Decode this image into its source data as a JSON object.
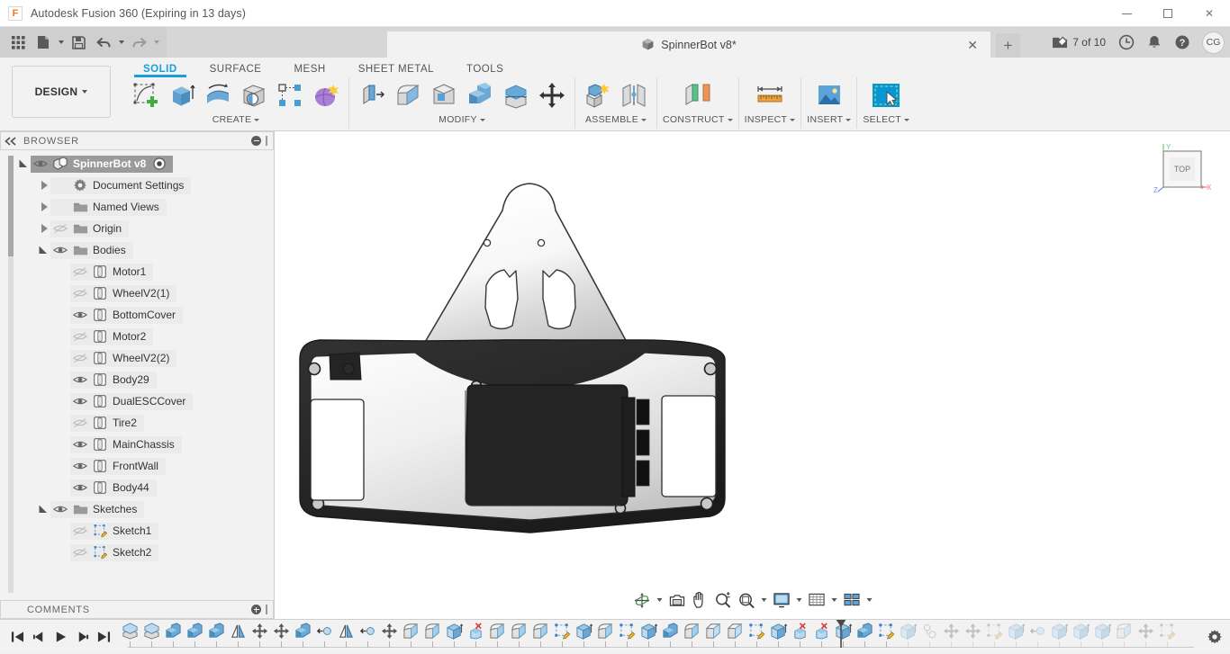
{
  "window": {
    "app_title": "Autodesk Fusion 360 (Expiring in 13 days)",
    "logo_letter": "F",
    "controls": {
      "minimize": "minimize",
      "maximize": "maximize",
      "close": "close"
    }
  },
  "quick_access": {
    "items": [
      {
        "name": "app-grid-button",
        "icon": "grid-icon"
      },
      {
        "name": "new-file-button",
        "icon": "file-icon",
        "has_caret": true
      },
      {
        "name": "save-button",
        "icon": "save-icon"
      },
      {
        "name": "undo-button",
        "icon": "undo-icon",
        "has_caret": true
      },
      {
        "name": "redo-button",
        "icon": "redo-icon",
        "has_caret": true
      }
    ]
  },
  "document_tab": {
    "label": "SpinnerBot v8*",
    "icon": "cube-icon",
    "close_glyph": "✕",
    "new_tab_glyph": "+"
  },
  "tab_right": {
    "job_status": "7 of 10",
    "job_icon": "job-status-icon",
    "history_icon": "clock-icon",
    "notification_icon": "bell-icon",
    "help_icon": "help-icon",
    "avatar_initials": "CG"
  },
  "workspace": {
    "label": "DESIGN"
  },
  "ribbon": {
    "tabs": [
      {
        "label": "SOLID",
        "active": true
      },
      {
        "label": "SURFACE",
        "active": false
      },
      {
        "label": "MESH",
        "active": false
      },
      {
        "label": "SHEET METAL",
        "active": false
      },
      {
        "label": "TOOLS",
        "active": false
      }
    ],
    "groups": [
      {
        "label": "CREATE",
        "has_caret": true,
        "icons": [
          "create-sketch-icon",
          "extrude-icon",
          "revolve-icon",
          "hole-icon",
          "pattern-icon",
          "form-icon"
        ]
      },
      {
        "label": "MODIFY",
        "has_caret": true,
        "icons": [
          "press-pull-icon",
          "fillet-icon",
          "shell-icon",
          "combine-icon",
          "offset-face-icon",
          "move-copy-icon"
        ]
      },
      {
        "label": "ASSEMBLE",
        "has_caret": true,
        "icons": [
          "new-component-icon",
          "joint-icon"
        ]
      },
      {
        "label": "CONSTRUCT",
        "has_caret": true,
        "icons": [
          "offset-plane-icon"
        ]
      },
      {
        "label": "INSPECT",
        "has_caret": true,
        "icons": [
          "measure-icon"
        ]
      },
      {
        "label": "INSERT",
        "has_caret": true,
        "icons": [
          "insert-image-icon"
        ]
      },
      {
        "label": "SELECT",
        "has_caret": true,
        "icons": [
          "select-window-icon"
        ]
      }
    ]
  },
  "browser": {
    "title": "BROWSER",
    "collapse_icon": "collapse-left-icon",
    "panel_button_icon": "minus-circle-icon",
    "tree": [
      {
        "label": "SpinnerBot v8",
        "depth": 0,
        "twisty": "down",
        "eye": "visible",
        "icon": "component-icon",
        "selected": true,
        "has_radio": true
      },
      {
        "label": "Document Settings",
        "depth": 1,
        "twisty": "right",
        "eye": "none",
        "icon": "gear-icon",
        "selected": false
      },
      {
        "label": "Named Views",
        "depth": 1,
        "twisty": "right",
        "eye": "none",
        "icon": "folder-icon",
        "selected": false
      },
      {
        "label": "Origin",
        "depth": 1,
        "twisty": "right",
        "eye": "hidden",
        "icon": "folder-icon",
        "selected": false
      },
      {
        "label": "Bodies",
        "depth": 1,
        "twisty": "down",
        "eye": "visible",
        "icon": "folder-icon",
        "selected": false
      },
      {
        "label": "Motor1",
        "depth": 2,
        "twisty": "none",
        "eye": "hidden",
        "icon": "body-icon",
        "selected": false
      },
      {
        "label": "WheelV2(1)",
        "depth": 2,
        "twisty": "none",
        "eye": "hidden",
        "icon": "body-icon",
        "selected": false
      },
      {
        "label": "BottomCover",
        "depth": 2,
        "twisty": "none",
        "eye": "visible",
        "icon": "body-icon",
        "selected": false
      },
      {
        "label": "Motor2",
        "depth": 2,
        "twisty": "none",
        "eye": "hidden",
        "icon": "body-icon",
        "selected": false
      },
      {
        "label": "WheelV2(2)",
        "depth": 2,
        "twisty": "none",
        "eye": "hidden",
        "icon": "body-icon",
        "selected": false
      },
      {
        "label": "Body29",
        "depth": 2,
        "twisty": "none",
        "eye": "visible",
        "icon": "body-icon",
        "selected": false
      },
      {
        "label": "DualESCCover",
        "depth": 2,
        "twisty": "none",
        "eye": "visible",
        "icon": "body-icon",
        "selected": false
      },
      {
        "label": "Tire2",
        "depth": 2,
        "twisty": "none",
        "eye": "hidden",
        "icon": "body-icon",
        "selected": false
      },
      {
        "label": "MainChassis",
        "depth": 2,
        "twisty": "none",
        "eye": "visible",
        "icon": "body-icon",
        "selected": false
      },
      {
        "label": "FrontWall",
        "depth": 2,
        "twisty": "none",
        "eye": "visible",
        "icon": "body-icon",
        "selected": false
      },
      {
        "label": "Body44",
        "depth": 2,
        "twisty": "none",
        "eye": "visible",
        "icon": "body-icon",
        "selected": false
      },
      {
        "label": "Sketches",
        "depth": 1,
        "twisty": "down",
        "eye": "visible",
        "icon": "folder-icon",
        "selected": false
      },
      {
        "label": "Sketch1",
        "depth": 2,
        "twisty": "none",
        "eye": "hidden",
        "icon": "sketch-icon",
        "selected": false
      },
      {
        "label": "Sketch2",
        "depth": 2,
        "twisty": "none",
        "eye": "hidden",
        "icon": "sketch-icon",
        "selected": false
      }
    ]
  },
  "comments": {
    "title": "COMMENTS",
    "add_icon": "plus-circle-icon"
  },
  "viewcube": {
    "face_label": "TOP",
    "axis_x": "X",
    "axis_y": "Y",
    "axis_z": "Z",
    "color_x": "#e87b7b",
    "color_y": "#7bc47b",
    "color_z": "#7b8be8"
  },
  "navbar": {
    "items": [
      {
        "name": "orbit-button",
        "icon": "orbit-icon",
        "caret": true
      },
      {
        "name": "look-at-button",
        "icon": "look-at-icon",
        "caret": false
      },
      {
        "name": "pan-button",
        "icon": "pan-hand-icon",
        "caret": false
      },
      {
        "name": "zoom-button",
        "icon": "zoom-icon",
        "caret": false
      },
      {
        "name": "fit-button",
        "icon": "fit-icon",
        "caret": true
      },
      {
        "name": "display-settings-button",
        "icon": "display-icon",
        "caret": true
      },
      {
        "name": "grid-snaps-button",
        "icon": "grid-snap-icon",
        "caret": true
      },
      {
        "name": "viewports-button",
        "icon": "viewports-icon",
        "caret": true
      }
    ]
  },
  "timeline": {
    "playback": [
      {
        "name": "go-to-beginning-button",
        "icon": "skip-back-icon"
      },
      {
        "name": "step-back-button",
        "icon": "step-back-icon"
      },
      {
        "name": "play-button",
        "icon": "play-icon"
      },
      {
        "name": "step-forward-button",
        "icon": "step-forward-icon"
      },
      {
        "name": "go-to-end-button",
        "icon": "skip-forward-icon"
      }
    ],
    "marker_index": 33,
    "settings_icon": "gear-icon",
    "features": [
      {
        "icon": "offset-face-icon",
        "suppressed": false
      },
      {
        "icon": "offset-face-icon",
        "suppressed": false
      },
      {
        "icon": "combine-icon",
        "suppressed": false
      },
      {
        "icon": "combine-icon",
        "suppressed": false
      },
      {
        "icon": "combine-icon",
        "suppressed": false
      },
      {
        "icon": "mirror-icon",
        "suppressed": false
      },
      {
        "icon": "move-copy-icon",
        "suppressed": false
      },
      {
        "icon": "move-copy-icon",
        "suppressed": false
      },
      {
        "icon": "combine-icon",
        "suppressed": false
      },
      {
        "icon": "revolve-joint-icon",
        "suppressed": false
      },
      {
        "icon": "mirror-icon",
        "suppressed": false
      },
      {
        "icon": "revolve-joint-icon",
        "suppressed": false
      },
      {
        "icon": "move-copy-icon",
        "suppressed": false
      },
      {
        "icon": "fillet-icon",
        "suppressed": false
      },
      {
        "icon": "fillet-icon",
        "suppressed": false
      },
      {
        "icon": "extrude-icon",
        "suppressed": false
      },
      {
        "icon": "delete-face-icon",
        "suppressed": false
      },
      {
        "icon": "fillet-icon",
        "suppressed": false
      },
      {
        "icon": "fillet-icon",
        "suppressed": false
      },
      {
        "icon": "fillet-icon",
        "suppressed": false
      },
      {
        "icon": "sketch-icon",
        "suppressed": false
      },
      {
        "icon": "extrude-icon",
        "suppressed": false
      },
      {
        "icon": "fillet-icon",
        "suppressed": false
      },
      {
        "icon": "sketch-icon",
        "suppressed": false
      },
      {
        "icon": "extrude-icon",
        "suppressed": false
      },
      {
        "icon": "combine-icon",
        "suppressed": false
      },
      {
        "icon": "fillet-icon",
        "suppressed": false
      },
      {
        "icon": "chamfer-icon",
        "suppressed": false
      },
      {
        "icon": "chamfer-icon",
        "suppressed": false
      },
      {
        "icon": "sketch-icon",
        "suppressed": false
      },
      {
        "icon": "extrude-icon",
        "suppressed": false
      },
      {
        "icon": "delete-face-icon",
        "suppressed": false
      },
      {
        "icon": "delete-face-icon",
        "suppressed": false
      },
      {
        "icon": "extrude-icon",
        "suppressed": false
      },
      {
        "icon": "combine-icon",
        "suppressed": false
      },
      {
        "icon": "sketch-icon",
        "suppressed": false
      },
      {
        "icon": "extrude-icon",
        "suppressed": true
      },
      {
        "icon": "thread-icon",
        "suppressed": true
      },
      {
        "icon": "move-copy-icon",
        "suppressed": true
      },
      {
        "icon": "move-copy-icon",
        "suppressed": true
      },
      {
        "icon": "sketch-icon",
        "suppressed": true
      },
      {
        "icon": "extrude-icon",
        "suppressed": true
      },
      {
        "icon": "revolve-joint-icon",
        "suppressed": true
      },
      {
        "icon": "extrude-icon",
        "suppressed": true
      },
      {
        "icon": "extrude-icon",
        "suppressed": true
      },
      {
        "icon": "extrude-icon",
        "suppressed": true
      },
      {
        "icon": "fillet-icon",
        "suppressed": true
      },
      {
        "icon": "move-copy-icon",
        "suppressed": true
      },
      {
        "icon": "sketch-icon",
        "suppressed": true
      }
    ]
  },
  "model": {
    "description": "SpinnerBot chassis top view - white/grey plate with black bottom cover"
  }
}
